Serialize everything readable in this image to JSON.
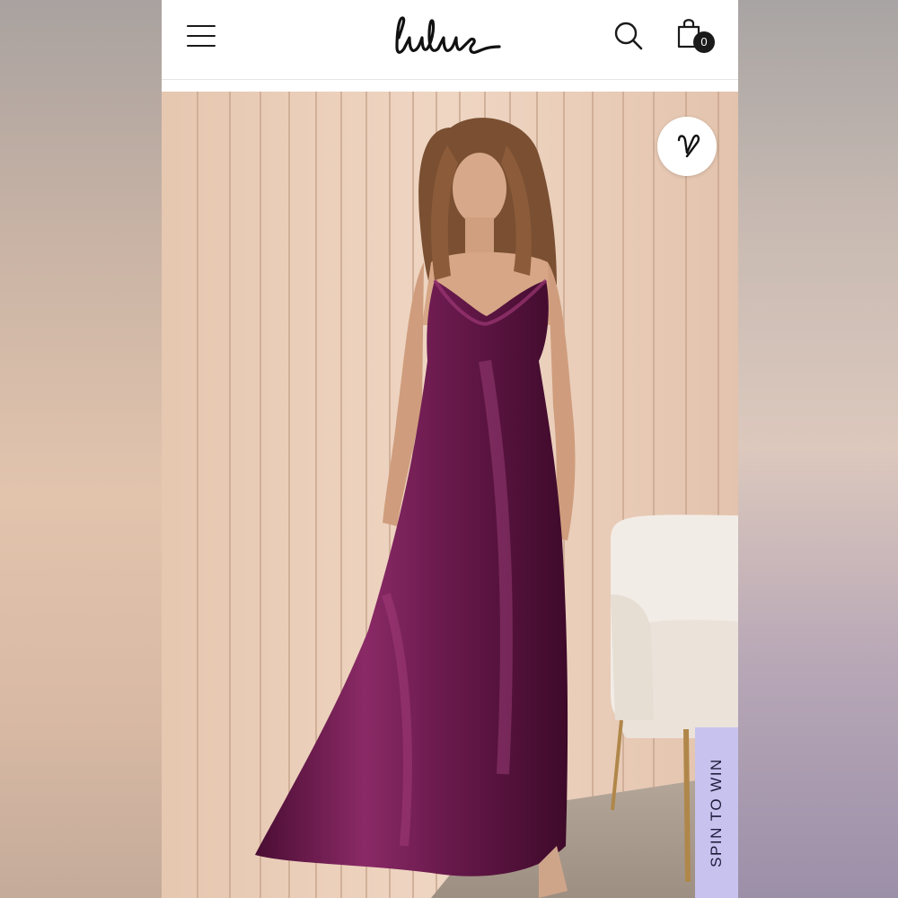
{
  "header": {
    "logo_text": "lulus",
    "menu_icon": "hamburger-menu-icon",
    "search_icon": "search-icon",
    "bag_icon": "shopping-bag-icon",
    "bag_count": "0"
  },
  "product": {
    "image": "model-in-plum-satin-maxi-dress",
    "dress_color": "#6f1b4f",
    "favorite_icon": "heart-outline-icon"
  },
  "promo": {
    "spin_label": "SPIN TO WIN",
    "spin_color": "#c7c3ee"
  }
}
